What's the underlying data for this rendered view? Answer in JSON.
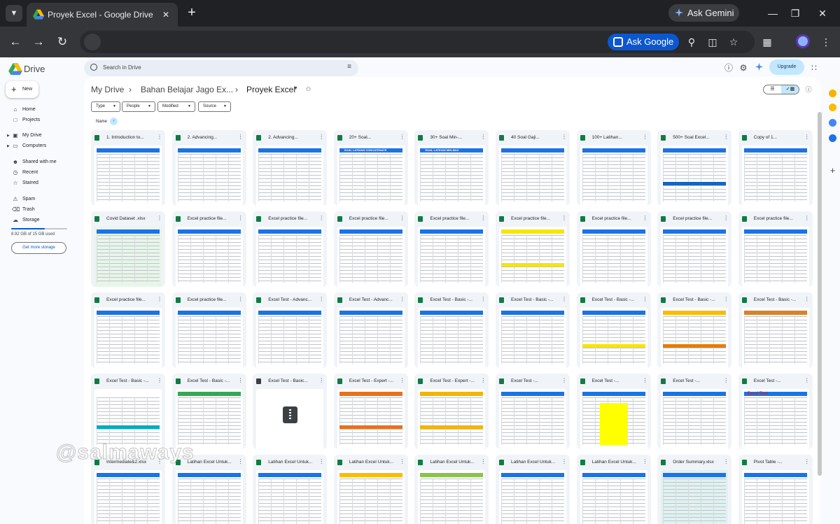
{
  "browser": {
    "tab_title": "Proyek Excel - Google Drive",
    "ask_gemini": "Ask Gemini",
    "ask_google": "Ask Google"
  },
  "drive": {
    "app_name": "Drive",
    "search_placeholder": "Search in Drive",
    "upgrade": "Upgrade",
    "new_button": "New"
  },
  "sidebar": {
    "items": [
      {
        "label": "Home",
        "icon": "home-icon"
      },
      {
        "label": "Projects",
        "icon": "projects-icon"
      },
      {
        "label": "My Drive",
        "icon": "my-drive-icon"
      },
      {
        "label": "Computers",
        "icon": "computers-icon"
      },
      {
        "label": "Shared with me",
        "icon": "shared-icon"
      },
      {
        "label": "Recent",
        "icon": "clock-icon"
      },
      {
        "label": "Starred",
        "icon": "star-icon"
      },
      {
        "label": "Spam",
        "icon": "spam-icon"
      },
      {
        "label": "Trash",
        "icon": "trash-icon"
      },
      {
        "label": "Storage",
        "icon": "cloud-icon"
      }
    ],
    "storage_text": "8.92 GB of 15 GB used",
    "storage_fraction": 0.595,
    "get_storage": "Get more storage"
  },
  "breadcrumb": {
    "root": "My Drive",
    "parent": "Bahan Belajar Jago Ex...",
    "current": "Proyek Excel"
  },
  "filters": [
    "Type",
    "People",
    "Modified",
    "Source"
  ],
  "sort_label": "Name",
  "colors": {
    "accent": "#0b57d0",
    "excel_green": "#107c41",
    "tab_active": "#353639",
    "page_bg": "#f8fafd"
  },
  "files": [
    {
      "name": "1. Introduction to..."
    },
    {
      "name": "2. Advancing..."
    },
    {
      "name": "2. Advancing..."
    },
    {
      "name": "20+ Soal..."
    },
    {
      "name": "30+ Soal Min-..."
    },
    {
      "name": "40 Soal Gaji..."
    },
    {
      "name": "100+ Latihan..."
    },
    {
      "name": "500+ Soal Excel..."
    },
    {
      "name": "Copy of 1..."
    },
    {
      "name": "Covid Dataset .xlsx"
    },
    {
      "name": "Excel practice file..."
    },
    {
      "name": "Excel practice file..."
    },
    {
      "name": "Excel practice file..."
    },
    {
      "name": "Excel practice file..."
    },
    {
      "name": "Excel practice file..."
    },
    {
      "name": "Excel practice file..."
    },
    {
      "name": "Excel practice file..."
    },
    {
      "name": "Excel practice file..."
    },
    {
      "name": "Excel practice file..."
    },
    {
      "name": "Excel practice file..."
    },
    {
      "name": "Excel Test - Advanc..."
    },
    {
      "name": "Excel Test - Advanc..."
    },
    {
      "name": "Excel Test - Basic -..."
    },
    {
      "name": "Excel Test - Basic -..."
    },
    {
      "name": "Excel Test - Basic -..."
    },
    {
      "name": "Excel Test - Basic -..."
    },
    {
      "name": "Excel Test - Basic -..."
    },
    {
      "name": "Excel Test - Basic -..."
    },
    {
      "name": "Excel Test - Basic -..."
    },
    {
      "name": "Excel Test - Basic..."
    },
    {
      "name": "Excel Test - Expert -..."
    },
    {
      "name": "Excel Test - Expert -..."
    },
    {
      "name": "Excel Test -..."
    },
    {
      "name": "Excel Test -..."
    },
    {
      "name": "Excel Test -..."
    },
    {
      "name": "Excel Test -..."
    },
    {
      "name": "Intermediate&2.xlsx"
    },
    {
      "name": "Latihan Excel Untuk..."
    },
    {
      "name": "Latihan Excel Untuk..."
    },
    {
      "name": "Latihan Excel Untuk..."
    },
    {
      "name": "Latihan Excel Untuk..."
    },
    {
      "name": "Latihan Excel Untuk..."
    },
    {
      "name": "Latihan Excel Untuk..."
    },
    {
      "name": "Order Summary.xlsx"
    },
    {
      "name": "Pivot Table -..."
    }
  ],
  "thumb_texts": {
    "soal20": "SOAL LATIHAN CONCATENATE",
    "soal30": "SOAL LATIHAN MIN-MAX",
    "excel_test": "Excel Test"
  },
  "watermark": "@salmaways"
}
